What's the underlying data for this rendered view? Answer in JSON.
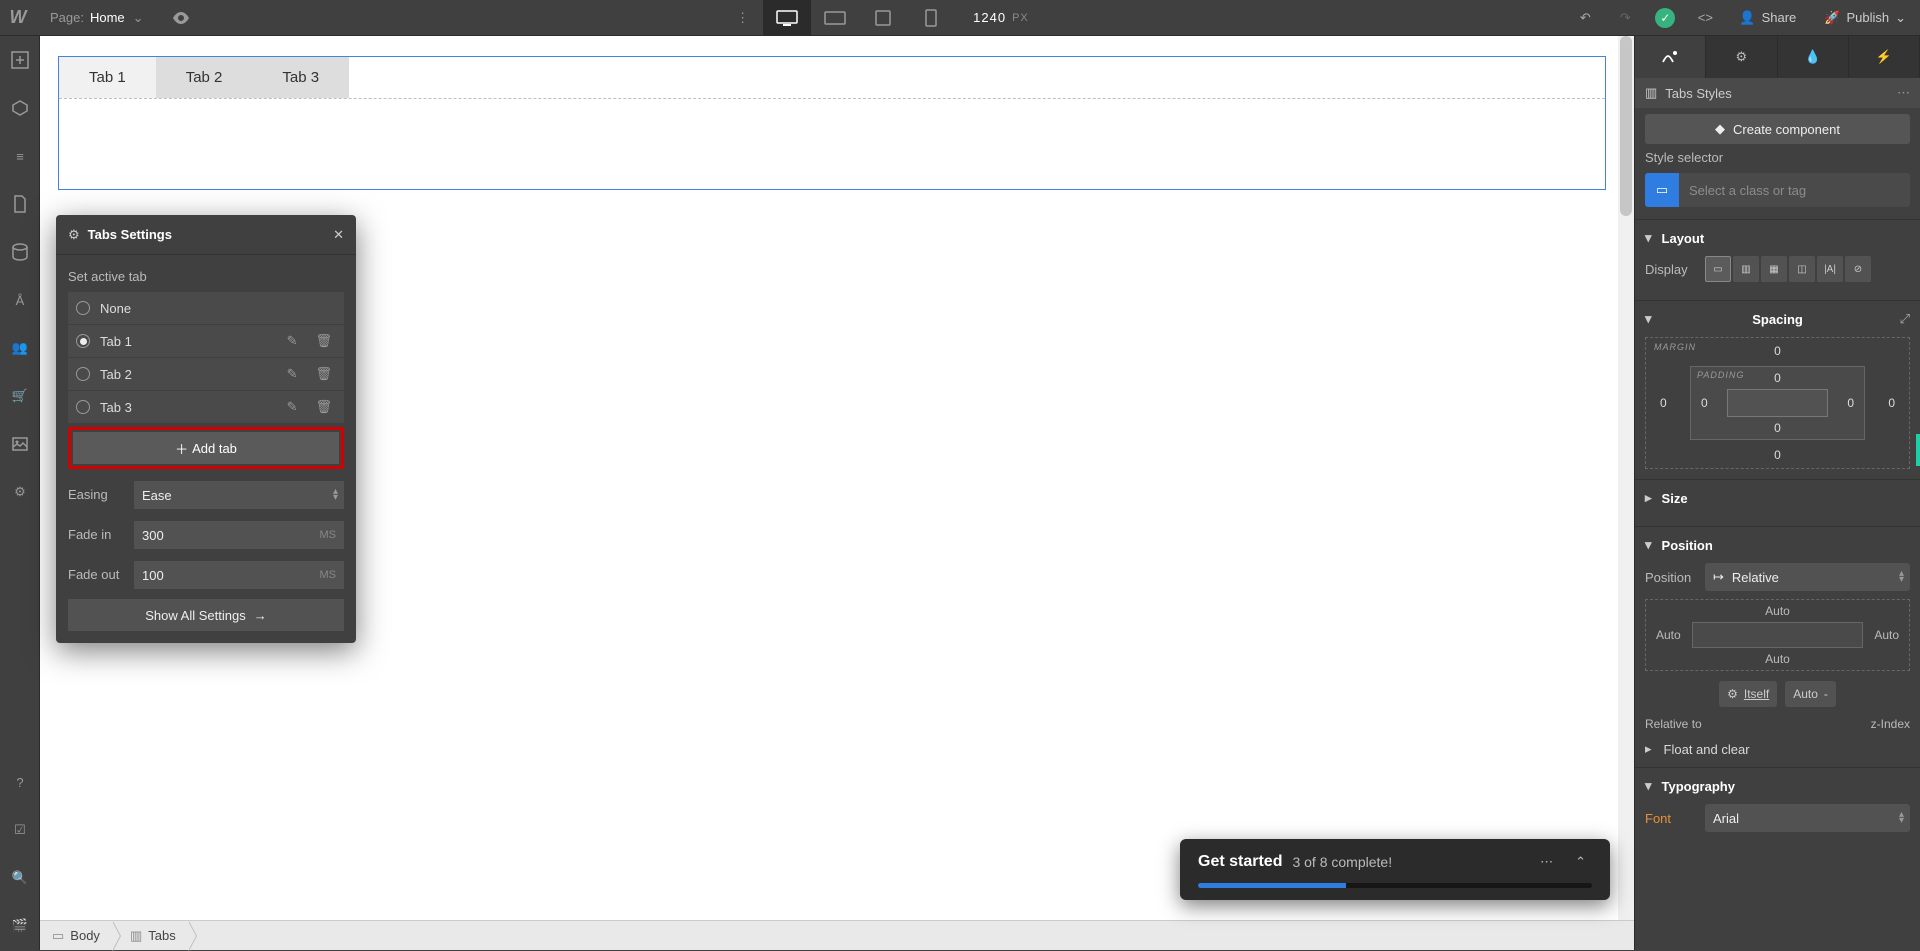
{
  "topbar": {
    "page_label": "Page:",
    "page_name": "Home",
    "canvas_width": "1240",
    "canvas_unit": "PX",
    "share_label": "Share",
    "publish_label": "Publish"
  },
  "canvas": {
    "tabs": [
      "Tab 1",
      "Tab 2",
      "Tab 3"
    ]
  },
  "breadcrumb": {
    "items": [
      "Body",
      "Tabs"
    ]
  },
  "popover": {
    "title": "Tabs Settings",
    "set_active_label": "Set active tab",
    "options": [
      {
        "label": "None",
        "selected": false,
        "editable": false
      },
      {
        "label": "Tab 1",
        "selected": true,
        "editable": true
      },
      {
        "label": "Tab 2",
        "selected": false,
        "editable": true
      },
      {
        "label": "Tab 3",
        "selected": false,
        "editable": true
      }
    ],
    "add_tab_label": "Add tab",
    "easing_label": "Easing",
    "easing_value": "Ease",
    "fade_in_label": "Fade in",
    "fade_in_value": "300",
    "fade_out_label": "Fade out",
    "fade_out_value": "100",
    "ms_unit": "MS",
    "show_all_label": "Show All Settings"
  },
  "toast": {
    "title": "Get started",
    "subtitle": "3 of 8 complete!",
    "progress_pct": 37.5
  },
  "rightpanel": {
    "styles_row_label": "Tabs Styles",
    "create_component_label": "Create component",
    "style_selector_label": "Style selector",
    "style_selector_placeholder": "Select a class or tag",
    "layout": {
      "heading": "Layout",
      "display_label": "Display"
    },
    "spacing": {
      "heading": "Spacing",
      "margin_label": "MARGIN",
      "padding_label": "PADDING",
      "margin": {
        "top": "0",
        "right": "0",
        "bottom": "0",
        "left": "0"
      },
      "padding": {
        "top": "0",
        "right": "0",
        "bottom": "0",
        "left": "0"
      }
    },
    "size": {
      "heading": "Size"
    },
    "position": {
      "heading": "Position",
      "position_label": "Position",
      "position_value": "Relative",
      "offsets": {
        "top": "Auto",
        "right": "Auto",
        "bottom": "Auto",
        "left": "Auto"
      },
      "itself_label": "Itself",
      "auto_label": "Auto",
      "relative_to_label": "Relative to",
      "zindex_label": "z-Index",
      "float_clear_label": "Float and clear"
    },
    "typography": {
      "heading": "Typography",
      "font_label": "Font",
      "font_value": "Arial"
    }
  }
}
